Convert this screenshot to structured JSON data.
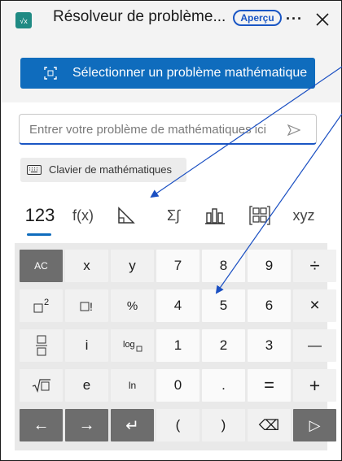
{
  "window": {
    "title": "Résolveur de problème...",
    "badge": "Aperçu",
    "more_label": "···"
  },
  "actions": {
    "select_problem": "Sélectionner un problème mathématique"
  },
  "input": {
    "placeholder": "Entrer votre problème de mathématiques ici"
  },
  "keyboard_button": {
    "label": "Clavier de mathématiques"
  },
  "tabs": [
    {
      "label": "123",
      "active": true
    },
    {
      "label": "f(x)"
    },
    {
      "icon": "triangle-icon"
    },
    {
      "label": "Σ∫"
    },
    {
      "icon": "bar-chart-icon"
    },
    {
      "icon": "matrix-icon"
    },
    {
      "label": "xyz"
    }
  ],
  "keypad": {
    "rows": [
      [
        "AC",
        "x",
        "y",
        "7",
        "8",
        "9",
        "÷"
      ],
      [
        "□²",
        "□!",
        "%",
        "4",
        "5",
        "6",
        "×"
      ],
      [
        "□/□",
        "i",
        "log□",
        "1",
        "2",
        "3",
        "—"
      ],
      [
        "√□",
        "e",
        "ln",
        "0",
        ".",
        "=",
        "+"
      ],
      [
        "←",
        "→",
        "↵",
        "(",
        ")",
        "⌫",
        "▷"
      ]
    ]
  },
  "colors": {
    "accent": "#0f6cbd",
    "annotation_arrow": "#1a4fc2",
    "dark_key": "#6d6d6d"
  }
}
